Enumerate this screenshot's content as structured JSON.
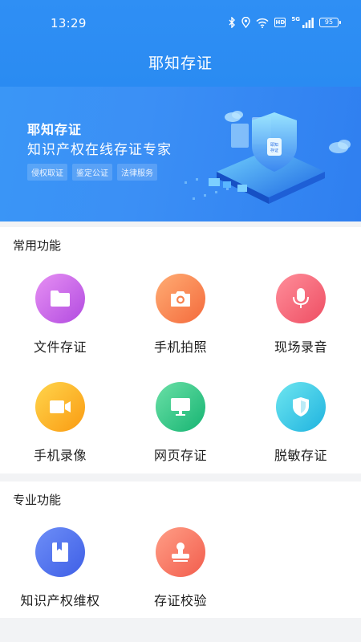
{
  "status_bar": {
    "time": "13:29",
    "hd": "HD",
    "network": "5G",
    "battery": "95"
  },
  "header": {
    "title": "耶知存证"
  },
  "banner": {
    "title": "耶知存证",
    "subtitle": "知识产权在线存证专家",
    "tags": [
      "侵权取证",
      "鉴定公证",
      "法律服务"
    ],
    "illustration_text": "耶知存证"
  },
  "common": {
    "title": "常用功能",
    "items": [
      {
        "label": "文件存证",
        "icon": "folder-icon",
        "color": "#c660ea"
      },
      {
        "label": "手机拍照",
        "icon": "camera-icon",
        "color": "#f7824e"
      },
      {
        "label": "现场录音",
        "icon": "microphone-icon",
        "color": "#f36476"
      },
      {
        "label": "手机录像",
        "icon": "video-camera-icon",
        "color": "#fcb227"
      },
      {
        "label": "网页存证",
        "icon": "monitor-icon",
        "color": "#2fc383"
      },
      {
        "label": "脱敏存证",
        "icon": "shield-icon",
        "color": "#3cc6e7"
      }
    ]
  },
  "pro": {
    "title": "专业功能",
    "items": [
      {
        "label": "知识产权维权",
        "icon": "book-icon",
        "color": "#5477ee"
      },
      {
        "label": "存证校验",
        "icon": "stamp-icon",
        "color": "#f47461"
      }
    ]
  }
}
